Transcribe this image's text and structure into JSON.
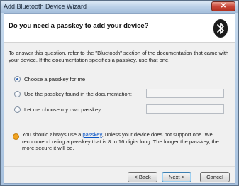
{
  "window": {
    "title": "Add Bluetooth Device Wizard",
    "close_glyph": "✕"
  },
  "header": {
    "title": "Do you need a passkey to add your device?",
    "logo_icon": "bluetooth-icon"
  },
  "description": "To answer this question, refer to the \"Bluetooth\" section of the documentation that came with your device. If the documentation specifies a passkey, use that one.",
  "options": [
    {
      "label": "Choose a passkey for me",
      "selected": true
    },
    {
      "label": "Use the passkey found in the documentation:",
      "selected": false,
      "value": ""
    },
    {
      "label": "Let me choose my own passkey:",
      "selected": false,
      "value": ""
    }
  ],
  "info": {
    "icon": "info-icon",
    "before_link": "You should always use a ",
    "link": "passkey",
    "after_link": ", unless your device does not support one. We recommend using a passkey that is 8 to 16 digits long. The longer the passkey, the more secure it will be."
  },
  "buttons": {
    "back": "< Back",
    "next": "Next >",
    "cancel": "Cancel"
  },
  "colors": {
    "bluetooth_badge": "#1c1c1c",
    "link": "#0a55c6",
    "info_badge": "#f1a321"
  }
}
